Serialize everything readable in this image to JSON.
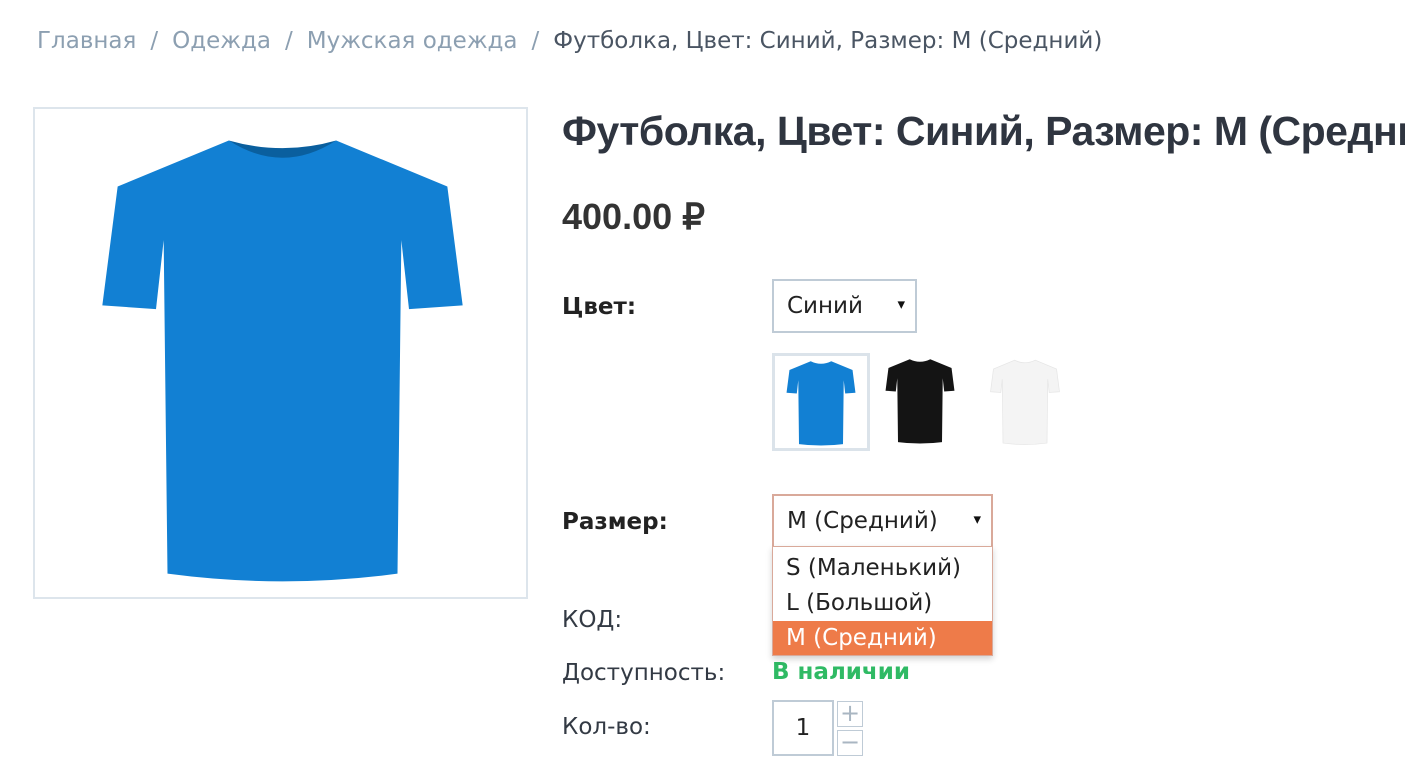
{
  "breadcrumb": {
    "items": [
      "Главная",
      "Одежда",
      "Мужская одежда"
    ],
    "separator": "/",
    "current": "Футболка, Цвет: Синий, Размер: M (Средний)"
  },
  "product": {
    "title": "Футболка, Цвет: Синий, Размер: M (Средний)",
    "price": "400.00 ₽",
    "image_color": "#1280d3"
  },
  "color_option": {
    "label": "Цвет:",
    "selected": "Синий",
    "swatches": [
      {
        "name": "blue",
        "color": "#1280d3",
        "selected": true
      },
      {
        "name": "black",
        "color": "#141414",
        "selected": false
      },
      {
        "name": "white",
        "color": "#f4f4f4",
        "selected": false
      }
    ]
  },
  "size_option": {
    "label": "Размер:",
    "selected": "M (Средний)",
    "options": [
      "S (Маленький)",
      "L (Большой)",
      "M (Средний)"
    ],
    "highlighted": "M (Средний)"
  },
  "details": {
    "sku_label": "КОД:",
    "availability_label": "Доступность:",
    "availability_value": "В наличии",
    "qty_label": "Кол-во:",
    "qty_value": "1",
    "plus": "+",
    "minus": "−"
  },
  "icons": {
    "dropdown_arrow": "▾",
    "accent_color": "#ee7b49",
    "in_stock_color": "#2fba64"
  }
}
